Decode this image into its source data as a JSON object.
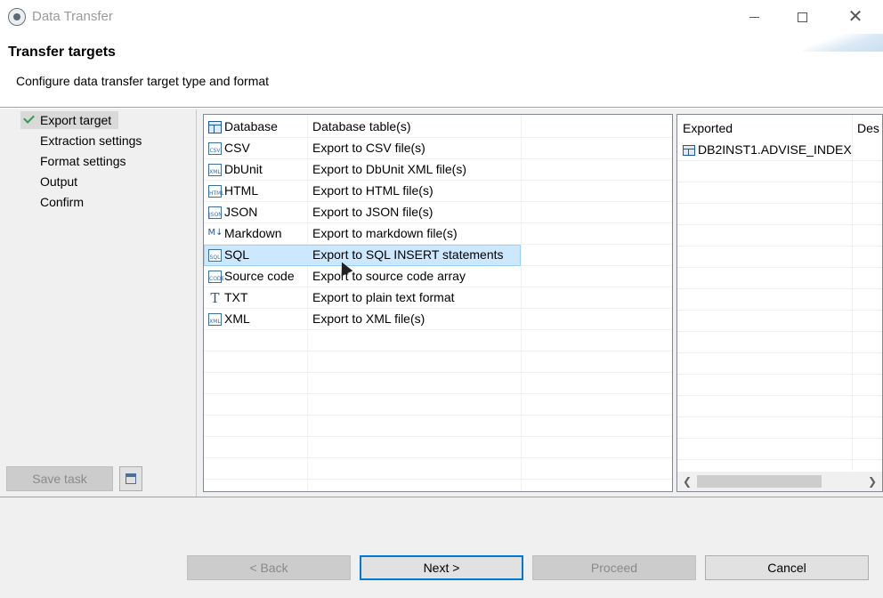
{
  "window": {
    "title": "Data Transfer",
    "minimize_icon": "minimize-icon",
    "maximize_icon": "maximize-icon",
    "close_icon": "close-icon",
    "close_glyph": "✕"
  },
  "header": {
    "title": "Transfer targets",
    "description": "Configure data transfer target type and format"
  },
  "steps": [
    {
      "label": "Export target",
      "selected": true,
      "completed": true
    },
    {
      "label": "Extraction settings"
    },
    {
      "label": "Format settings"
    },
    {
      "label": "Output"
    },
    {
      "label": "Confirm"
    }
  ],
  "save_task": {
    "label": "Save task",
    "icon": "save-task-icon"
  },
  "formats": [
    {
      "name": "Database",
      "description": "Database table(s)",
      "icon": "database-table-icon",
      "glyph": ""
    },
    {
      "name": "CSV",
      "description": "Export to CSV file(s)",
      "icon": "csv-file-icon",
      "glyph": "CSV"
    },
    {
      "name": "DbUnit",
      "description": "Export to DbUnit XML file(s)",
      "icon": "xml-file-icon",
      "glyph": "XML"
    },
    {
      "name": "HTML",
      "description": "Export to HTML file(s)",
      "icon": "html-file-icon",
      "glyph": "HTML"
    },
    {
      "name": "JSON",
      "description": "Export to JSON file(s)",
      "icon": "json-file-icon",
      "glyph": "JSON"
    },
    {
      "name": "Markdown",
      "description": "Export to markdown file(s)",
      "icon": "markdown-icon",
      "glyph": "M↓"
    },
    {
      "name": "SQL",
      "description": "Export to SQL INSERT statements",
      "icon": "sql-file-icon",
      "glyph": "SQL",
      "selected": true
    },
    {
      "name": "Source code",
      "description": "Export to source code array",
      "icon": "code-file-icon",
      "glyph": "CODE"
    },
    {
      "name": "TXT",
      "description": "Export to plain text format",
      "icon": "text-icon",
      "glyph": "T"
    },
    {
      "name": "XML",
      "description": "Export to XML file(s)",
      "icon": "xml-file-icon",
      "glyph": "XML"
    }
  ],
  "exported": {
    "headers": [
      "Exported",
      "Des"
    ],
    "rows": [
      {
        "name": "DB2INST1.ADVISE_INDEX",
        "icon": "table-icon"
      }
    ]
  },
  "buttons": {
    "back": "< Back",
    "next": "Next >",
    "proceed": "Proceed",
    "cancel": "Cancel"
  },
  "colors": {
    "selection": "#cce8ff",
    "selection_border": "#99d1ff",
    "default_button_border": "#0078d7",
    "check": "#2f9e44"
  }
}
